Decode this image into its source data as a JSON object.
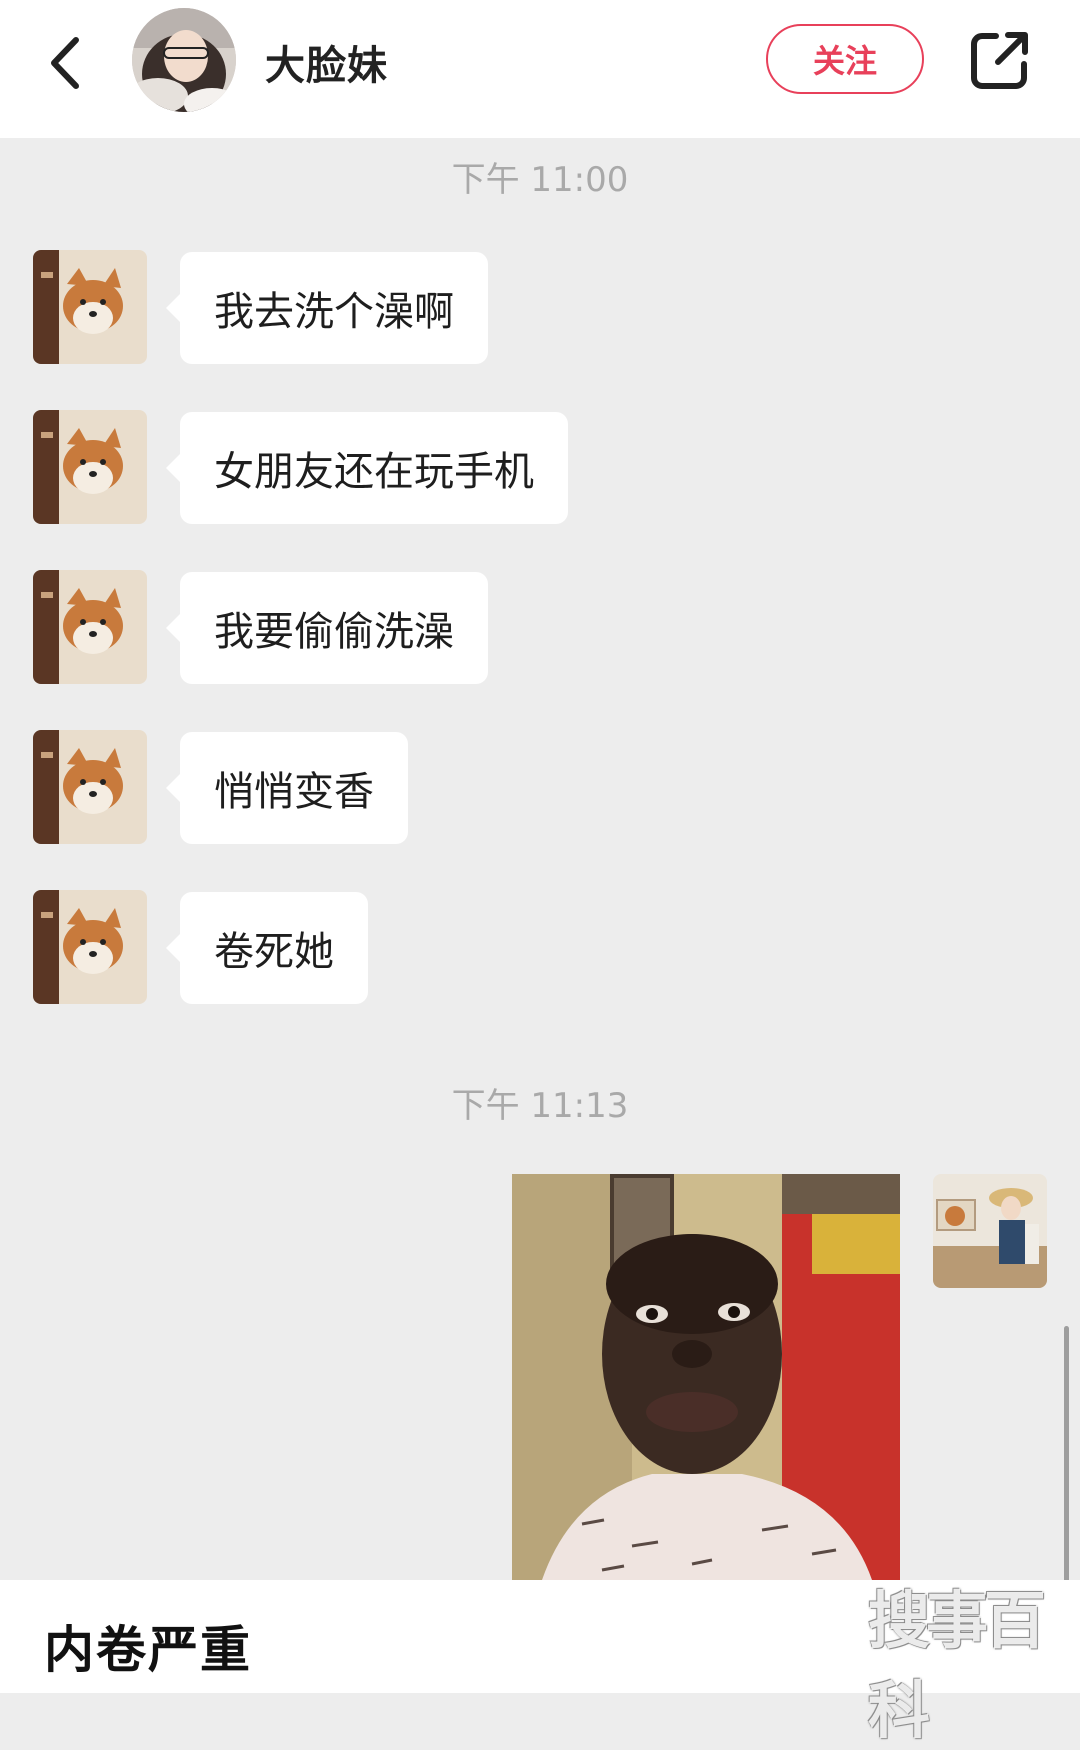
{
  "header": {
    "contact_name": "大脸妹",
    "follow_label": "关注"
  },
  "chat": {
    "timestamps": [
      "下午 11:00",
      "下午 11:13"
    ],
    "messages": [
      {
        "text": "我去洗个澡啊"
      },
      {
        "text": "女朋友还在玩手机"
      },
      {
        "text": "我要偷偷洗澡"
      },
      {
        "text": "悄悄变香"
      },
      {
        "text": "卷死她"
      }
    ]
  },
  "footer": {
    "caption": "内卷严重",
    "watermark": "搜事百科"
  },
  "colors": {
    "accent": "#e8405a",
    "chat_background": "#ededed",
    "bubble": "#ffffff",
    "timestamp": "#a9a9a9"
  },
  "icons": {
    "back": "chevron-left-icon",
    "share": "share-external-icon"
  }
}
